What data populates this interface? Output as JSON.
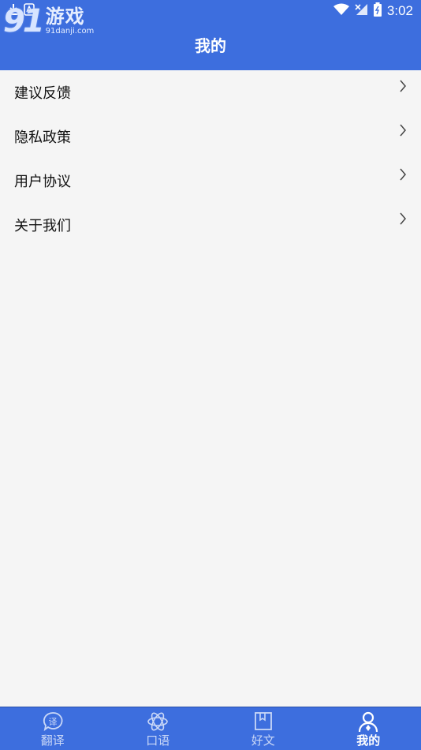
{
  "status_bar": {
    "time": "3:02"
  },
  "watermark": {
    "logo_number": "91",
    "logo_text": "游戏",
    "url": "91danji.com"
  },
  "header": {
    "title": "我的"
  },
  "menu": {
    "items": [
      {
        "label": "建议反馈"
      },
      {
        "label": "隐私政策"
      },
      {
        "label": "用户协议"
      },
      {
        "label": "关于我们"
      }
    ]
  },
  "tabbar": {
    "tabs": [
      {
        "label": "翻译",
        "icon": "translate-icon",
        "active": false
      },
      {
        "label": "口语",
        "icon": "atom-icon",
        "active": false
      },
      {
        "label": "好文",
        "icon": "bookmark-icon",
        "active": false
      },
      {
        "label": "我的",
        "icon": "user-icon",
        "active": true
      }
    ]
  },
  "colors": {
    "primary": "#3d6ede",
    "background": "#f5f5f5"
  }
}
